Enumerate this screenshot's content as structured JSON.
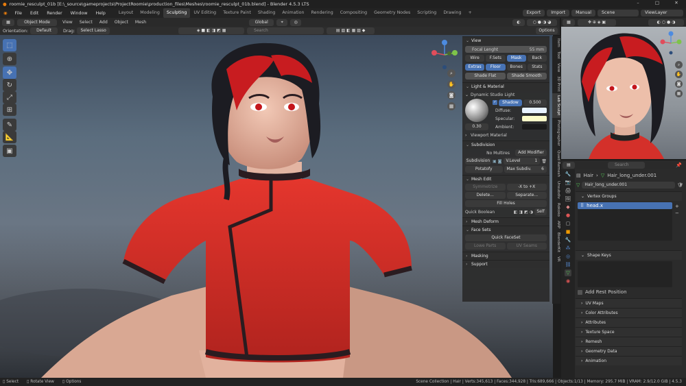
{
  "window_title": "roomie_resculpt_01b [E:\\_source\\gameprojects\\ProjectRoomie\\production_files\\Meshes\\roomie_resculpt_01b.blend] - Blender 4.5.3 LTS",
  "menus": [
    "File",
    "Edit",
    "Render",
    "Window",
    "Help"
  ],
  "workspaces": [
    "Layout",
    "Modeling",
    "Sculpting",
    "UV Editing",
    "Texture Paint",
    "Shading",
    "Animation",
    "Rendering",
    "Compositing",
    "Geometry Nodes",
    "Scripting",
    "Drawing"
  ],
  "active_workspace": "Sculpting",
  "top_right": {
    "export": "Export",
    "import": "Import",
    "manual": "Manual",
    "scene": "Scene",
    "view_layer": "ViewLayer"
  },
  "vp_header": {
    "mode": "Object Mode",
    "view": "View",
    "select": "Select",
    "add": "Add",
    "object": "Object",
    "mesh": "Mesh",
    "orientation_label": "Orientation:",
    "orientation": "Default",
    "drag_label": "Drag:",
    "drag": "Select Lasso",
    "transform": "Global",
    "search_placeholder": "Search",
    "options": "Options"
  },
  "npanel": {
    "view": {
      "title": "View",
      "focal_label": "Focal Lenght",
      "focal_value": "55 mm",
      "wire": "Wire",
      "fsets": "F.Sets",
      "mask": "Mask",
      "back": "Back",
      "extras": "Extras",
      "floor": "Floor",
      "bones": "Bones",
      "stats": "Stats",
      "shade_flat": "Shade Flat",
      "shade_smooth": "Shade Smooth"
    },
    "light": {
      "title": "Light & Material",
      "studio": "Dynamic Studio Light",
      "shadow": "Shadow",
      "shadow_val": "0.500",
      "diffuse": "Diffuse:",
      "specular": "Specular:",
      "ambient": "Ambient:",
      "sphere_val": "0.30",
      "viewport_material": "Viewport Material"
    },
    "subdiv": {
      "title": "Subdivision",
      "no_multires": "No Multires",
      "add_modifier": "Add Modifier",
      "subdivision": "Subdivision",
      "vlevel": "V.Level",
      "vlevel_val": "1",
      "potatofy": "Potatofy",
      "max_subdiv": "Max Subdiv.",
      "max_subdiv_val": "6"
    },
    "mesh_edit": {
      "title": "Mesh Edit",
      "symmetrize": "Symmetrize",
      "sym_axis": "-X to +X",
      "delete": "Delete...",
      "separate": "Separate...",
      "fill_holes": "Fill Holes",
      "quick_boolean": "Quick Boolean",
      "self": "Self"
    },
    "mesh_deform": "Mesh Deform",
    "face_sets": {
      "title": "Face Sets",
      "quick": "Quick FaceSet",
      "lowe_parts": "Lowe Parts",
      "uv_seams": "UV Seams"
    },
    "masking": "Masking",
    "support": "Support"
  },
  "side_tabs": [
    "Item",
    "Tool",
    "View",
    "3D Print",
    "Lab Sculpt",
    "Photographer",
    "Quad Remesh",
    "Unsubdiv",
    "Rokoko",
    "ARP",
    "BlenderKit",
    "VR"
  ],
  "active_side_tab": "Lab Sculpt",
  "properties": {
    "search_placeholder": "Search",
    "breadcrumb_object": "Hair",
    "breadcrumb_mesh": "Hair_long_under.001",
    "mesh_name": "Hair_long_under.001",
    "vertex_groups_title": "Vertex Groups",
    "vertex_group_item": "head.x",
    "shape_keys_title": "Shape Keys",
    "add_rest_position": "Add Rest Position",
    "sections": [
      "UV Maps",
      "Color Attributes",
      "Attributes",
      "Texture Space",
      "Remesh",
      "Geometry Data",
      "Animation"
    ]
  },
  "statusbar": {
    "select": "Select",
    "rotate": "Rotate View",
    "options": "Options",
    "info": "Scene Collection | Hair | Verts:345,613 | Faces:344,928 | Tris:689,666 | Objects:1/13 | Memory: 295.7 MiB | VRAM: 2.9/12.0 GiB | 4.5.3"
  },
  "colors": {
    "accent": "#4772b3",
    "shirt": "#d8312b",
    "hair": "#1c1c22",
    "skin": "#e8b9a5"
  }
}
